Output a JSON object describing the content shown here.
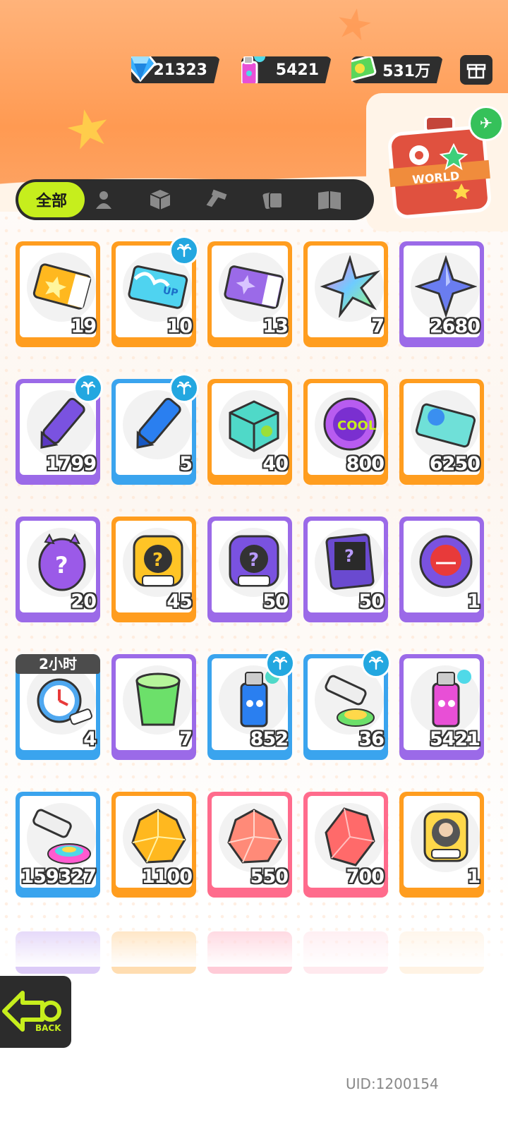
{
  "currency": {
    "diamond": "21323",
    "spray": "5421",
    "cash": "531万"
  },
  "suitcase_label": "WORLD",
  "tabs": {
    "active_label": "全部",
    "icons": [
      "person-icon",
      "box-icon",
      "spray-gun-icon",
      "cards-icon",
      "book-icon"
    ]
  },
  "items": [
    {
      "count": "19",
      "frame": "orange",
      "art": "gold-ticket",
      "palm": false
    },
    {
      "count": "10",
      "frame": "orange",
      "art": "wave-up-ticket",
      "palm": true
    },
    {
      "count": "13",
      "frame": "orange",
      "art": "purple-ticket",
      "palm": false
    },
    {
      "count": "7",
      "frame": "orange",
      "art": "rainbow-star",
      "palm": false
    },
    {
      "count": "2680",
      "frame": "purple",
      "art": "blue-star",
      "palm": false
    },
    {
      "count": "1799",
      "frame": "purple",
      "art": "purple-crayon",
      "palm": true
    },
    {
      "count": "5",
      "frame": "blue",
      "art": "blue-crayon",
      "palm": true
    },
    {
      "count": "40",
      "frame": "orange",
      "art": "color-box",
      "palm": false
    },
    {
      "count": "800",
      "frame": "orange",
      "art": "cool-badge",
      "palm": false
    },
    {
      "count": "6250",
      "frame": "orange",
      "art": "season-ticket",
      "palm": false
    },
    {
      "count": "20",
      "frame": "purple",
      "art": "mystery-egg",
      "palm": false
    },
    {
      "count": "45",
      "frame": "orange",
      "art": "deity-mystery-gold",
      "palm": false
    },
    {
      "count": "50",
      "frame": "purple",
      "art": "deity-mystery-purple",
      "palm": false
    },
    {
      "count": "50",
      "frame": "purple",
      "art": "travel-card",
      "palm": false
    },
    {
      "count": "1",
      "frame": "purple",
      "art": "fish-badge",
      "palm": false
    },
    {
      "count": "4",
      "frame": "blue",
      "art": "alarm-clock",
      "palm": false,
      "timer": "2小时"
    },
    {
      "count": "7",
      "frame": "purple",
      "art": "green-cup",
      "palm": false
    },
    {
      "count": "852",
      "frame": "blue",
      "art": "blue-spray",
      "palm": true
    },
    {
      "count": "36",
      "frame": "blue",
      "art": "paint-tube",
      "palm": true
    },
    {
      "count": "5421",
      "frame": "purple",
      "art": "pink-spray",
      "palm": false
    },
    {
      "count": "159327",
      "frame": "blue",
      "art": "rainbow-tube",
      "palm": false
    },
    {
      "count": "1100",
      "frame": "orange",
      "art": "gold-crystal",
      "palm": false
    },
    {
      "count": "550",
      "frame": "pink",
      "art": "pink-crystal",
      "palm": false
    },
    {
      "count": "700",
      "frame": "pink",
      "art": "red-gem",
      "palm": false
    },
    {
      "count": "1",
      "frame": "orange",
      "art": "deity-avatar-badge",
      "palm": false
    }
  ],
  "back_label": "BACK",
  "uid": "UID:1200154",
  "colors": {
    "orange": "#ff9d1f",
    "purple": "#9b6ae8",
    "blue": "#3aa4ee",
    "pink": "#ff6b8c",
    "accent": "#c6ee1d"
  }
}
